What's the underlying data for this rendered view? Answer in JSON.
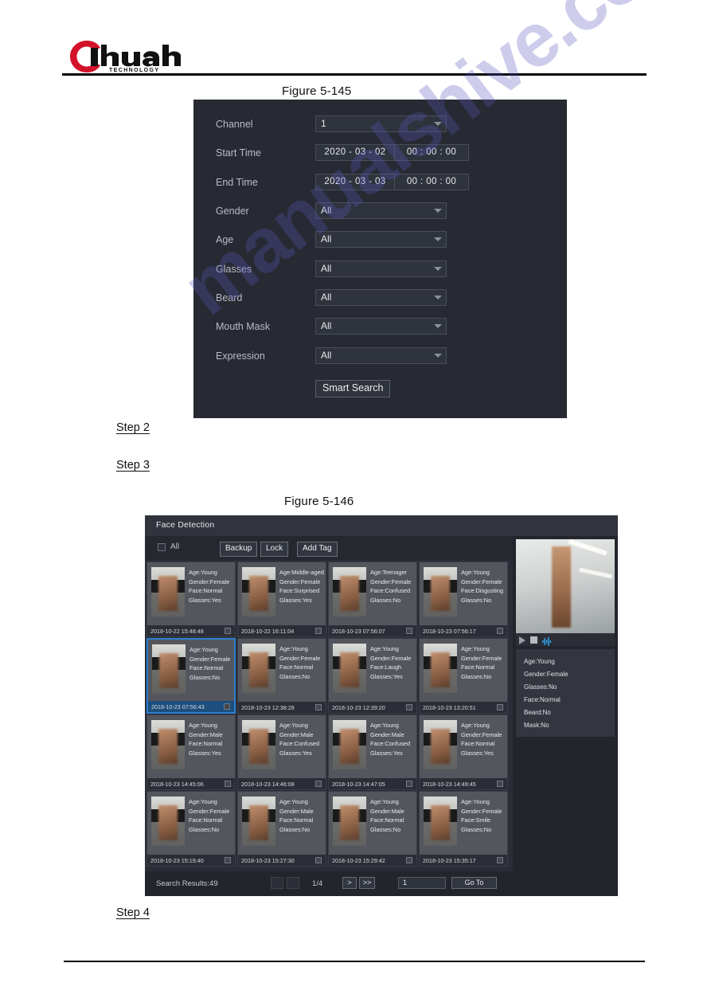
{
  "brand": {
    "name": "alhua",
    "tagline": "TECHNOLOGY"
  },
  "watermark": {
    "line1": "manualshive.com"
  },
  "captions": {
    "fig145": "Figure 5-145",
    "fig146": "Figure 5-146"
  },
  "steps": {
    "step2": "Step 2",
    "step3": "Step 3",
    "step4": "Step 4"
  },
  "search_dialog": {
    "fields": [
      {
        "label": "Channel",
        "type": "select",
        "value": "1"
      },
      {
        "label": "Start Time",
        "type": "datetime",
        "date": "2020 - 03 - 02",
        "time": "00 : 00 : 00"
      },
      {
        "label": "End Time",
        "type": "datetime",
        "date": "2020 - 03 - 03",
        "time": "00 : 00 : 00"
      },
      {
        "label": "Gender",
        "type": "select",
        "value": "All"
      },
      {
        "label": "Age",
        "type": "select",
        "value": "All"
      },
      {
        "label": "Glasses",
        "type": "select",
        "value": "All"
      },
      {
        "label": "Beard",
        "type": "select",
        "value": "All"
      },
      {
        "label": "Mouth Mask",
        "type": "select",
        "value": "All"
      },
      {
        "label": "Expression",
        "type": "select",
        "value": "All"
      }
    ],
    "submit_label": "Smart Search"
  },
  "face_detection": {
    "title": "Face Detection",
    "toolbar": {
      "select_all_label": "All",
      "backup_label": "Backup",
      "lock_label": "Lock",
      "add_tag_label": "Add Tag"
    },
    "results": [
      {
        "age": "Age:Young",
        "gender": "Gender:Female",
        "face": "Face:Normal",
        "glasses": "Glasses:Yes",
        "time": "2018-10-22 15:48:48",
        "selected": false
      },
      {
        "age": "Age:Middle-aged",
        "gender": "Gender:Female",
        "face": "Face:Surprised",
        "glasses": "Glasses:Yes",
        "time": "2018-10-22 16:11:04",
        "selected": false
      },
      {
        "age": "Age:Teenager",
        "gender": "Gender:Female",
        "face": "Face:Confused",
        "glasses": "Glasses:No",
        "time": "2018-10-23 07:56:07",
        "selected": false
      },
      {
        "age": "Age:Young",
        "gender": "Gender:Female",
        "face": "Face:Disgusting",
        "glasses": "Glasses:No",
        "time": "2018-10-23 07:56:17",
        "selected": false
      },
      {
        "age": "Age:Young",
        "gender": "Gender:Female",
        "face": "Face:Normal",
        "glasses": "Glasses:No",
        "time": "2018-10-23 07:56:43",
        "selected": true
      },
      {
        "age": "Age:Young",
        "gender": "Gender:Female",
        "face": "Face:Normal",
        "glasses": "Glasses:No",
        "time": "2018-10-23 12:38:28",
        "selected": false
      },
      {
        "age": "Age:Young",
        "gender": "Gender:Female",
        "face": "Face:Laugh",
        "glasses": "Glasses:Yes",
        "time": "2018-10-23 12:39:20",
        "selected": false
      },
      {
        "age": "Age:Young",
        "gender": "Gender:Female",
        "face": "Face:Normal",
        "glasses": "Glasses:No",
        "time": "2018-10-23 13:20:51",
        "selected": false
      },
      {
        "age": "Age:Young",
        "gender": "Gender:Male",
        "face": "Face:Normal",
        "glasses": "Glasses:Yes",
        "time": "2018-10-23 14:45:06",
        "selected": false
      },
      {
        "age": "Age:Young",
        "gender": "Gender:Male",
        "face": "Face:Confused",
        "glasses": "Glasses:Yes",
        "time": "2018-10-23 14:46:08",
        "selected": false
      },
      {
        "age": "Age:Young",
        "gender": "Gender:Male",
        "face": "Face:Confused",
        "glasses": "Glasses:Yes",
        "time": "2018-10-23 14:47:05",
        "selected": false
      },
      {
        "age": "Age:Young",
        "gender": "Gender:Female",
        "face": "Face:Normal",
        "glasses": "Glasses:Yes",
        "time": "2018-10-23 14:49:45",
        "selected": false
      },
      {
        "age": "Age:Young",
        "gender": "Gender:Female",
        "face": "Face:Normal",
        "glasses": "Glasses:No",
        "time": "2018-10-23 15:19:40",
        "selected": false
      },
      {
        "age": "Age:Young",
        "gender": "Gender:Male",
        "face": "Face:Normal",
        "glasses": "Glasses:No",
        "time": "2018-10-23 15:27:30",
        "selected": false
      },
      {
        "age": "Age:Young",
        "gender": "Gender:Male",
        "face": "Face:Normal",
        "glasses": "Glasses:No",
        "time": "2018-10-23 15:29:42",
        "selected": false
      },
      {
        "age": "Age:Young",
        "gender": "Gender:Female",
        "face": "Face:Smile",
        "glasses": "Glasses:No",
        "time": "2018-10-23 15:35:17",
        "selected": false
      }
    ],
    "preview": {
      "attributes": [
        "Age:Young",
        "Gender:Female",
        "Glasses:No",
        "Face:Normal",
        "Beard:No",
        "Mask:No"
      ]
    },
    "footer": {
      "search_results": "Search Results:49",
      "page_indicator": "1/4",
      "next_label": ">",
      "last_label": ">>",
      "page_input_value": "1",
      "goto_label": "Go To"
    }
  },
  "colors": {
    "dialog_bg": "#272a32",
    "panel_bg": "#2a2d35",
    "accent_blue": "#2f7fd0",
    "brand_red": "#d3122a"
  }
}
